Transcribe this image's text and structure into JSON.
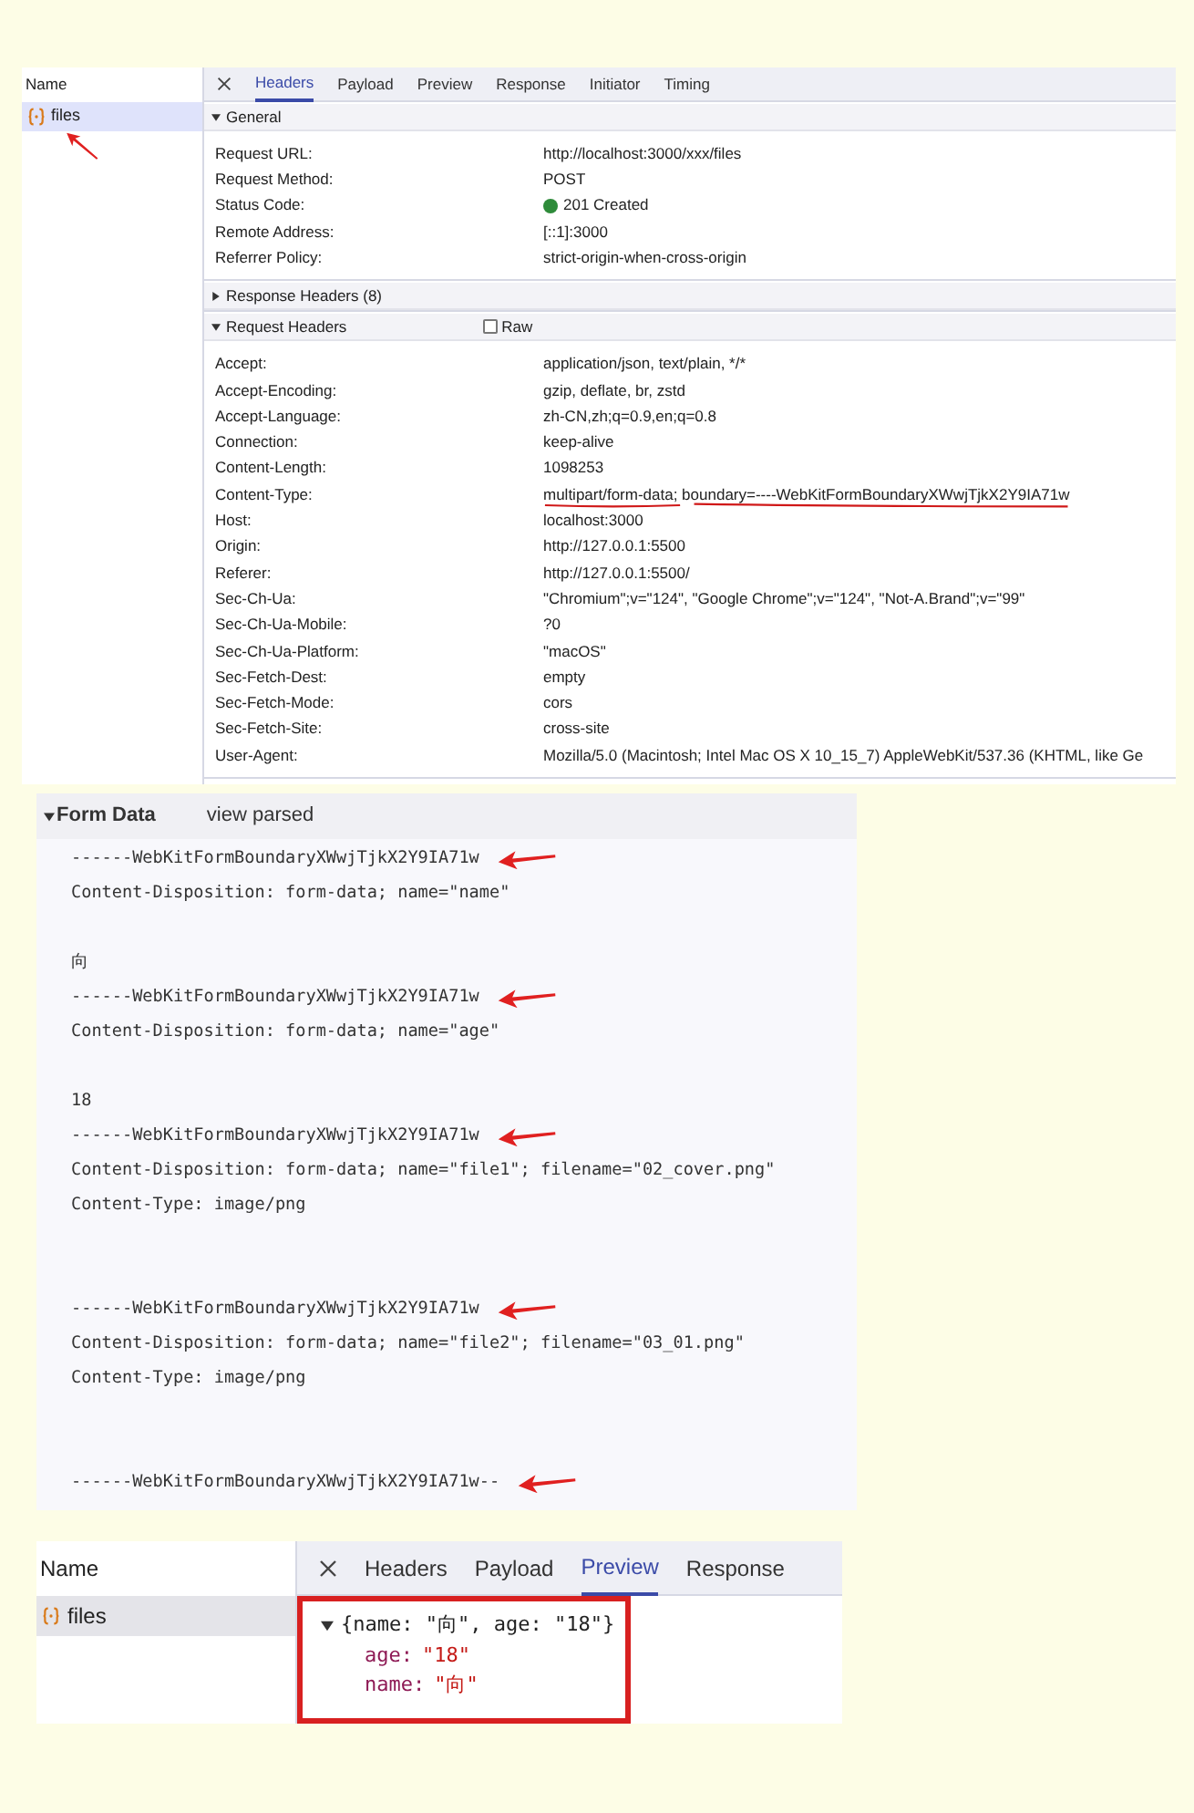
{
  "headers_view": {
    "name_column": {
      "heading": "Name",
      "items": [
        {
          "label": "files",
          "selected": true,
          "arrow": true
        }
      ]
    },
    "tabs": [
      {
        "label": "Headers",
        "selected": true
      },
      {
        "label": "Payload",
        "selected": false
      },
      {
        "label": "Preview",
        "selected": false
      },
      {
        "label": "Response",
        "selected": false
      },
      {
        "label": "Initiator",
        "selected": false
      },
      {
        "label": "Timing",
        "selected": false
      }
    ],
    "sections": [
      {
        "title": "General",
        "expanded": true,
        "rows": [
          {
            "name": "Request URL:",
            "value": "http://localhost:3000/xxx/files"
          },
          {
            "name": "Request Method:",
            "value": "POST"
          },
          {
            "name": "Status Code:",
            "value": "201 Created",
            "color": "#2e8b3a"
          },
          {
            "name": "Remote Address:",
            "value": "[::1]:3000"
          },
          {
            "name": "Referrer Policy:",
            "value": "strict-origin-when-cross-origin"
          }
        ]
      },
      {
        "title": "Response Headers (8)",
        "expanded": false
      },
      {
        "title": "Request Headers",
        "expanded": true,
        "raw": {
          "label": "Raw",
          "checked": false
        },
        "rows": [
          {
            "name": "Accept:",
            "value": "application/json, text/plain, */*"
          },
          {
            "name": "Accept-Encoding:",
            "value": "gzip, deflate, br, zstd"
          },
          {
            "name": "Accept-Language:",
            "value": "zh-CN,zh;q=0.9,en;q=0.8"
          },
          {
            "name": "Connection:",
            "value": "keep-alive"
          },
          {
            "name": "Content-Length:",
            "value": "1098253"
          },
          {
            "name": "Content-Type:",
            "value": "multipart/form-data; boundary=----WebKitFormBoundaryXWwjTjkX2Y9IA71w",
            "underlined": true
          },
          {
            "name": "Host:",
            "value": "localhost:3000"
          },
          {
            "name": "Origin:",
            "value": "http://127.0.0.1:5500"
          },
          {
            "name": "Referer:",
            "value": "http://127.0.0.1:5500/"
          },
          {
            "name": "Sec-Ch-Ua:",
            "value": "\"Chromium\";v=\"124\", \"Google Chrome\";v=\"124\", \"Not-A.Brand\";v=\"99\""
          },
          {
            "name": "Sec-Ch-Ua-Mobile:",
            "value": "?0"
          },
          {
            "name": "Sec-Ch-Ua-Platform:",
            "value": "\"macOS\""
          },
          {
            "name": "Sec-Fetch-Dest:",
            "value": "empty"
          },
          {
            "name": "Sec-Fetch-Mode:",
            "value": "cors"
          },
          {
            "name": "Sec-Fetch-Site:",
            "value": "cross-site"
          },
          {
            "name": "User-Agent:",
            "value": "Mozilla/5.0 (Macintosh; Intel Mac OS X 10_15_7) AppleWebKit/537.36 (KHTML, like Ge"
          }
        ]
      }
    ]
  },
  "form_data": {
    "title": "Form Data",
    "expanded": true,
    "link": "view parsed",
    "lines": [
      {
        "kind": "text",
        "text": "------WebKitFormBoundaryXWwjTjkX2Y9IA71w",
        "arrow": true
      },
      {
        "kind": "text",
        "text": "Content-Disposition: form-data; name=\"name\"",
        "arrow": false
      },
      {
        "kind": "blank"
      },
      {
        "kind": "text",
        "text": "向",
        "arrow": false
      },
      {
        "kind": "text",
        "text": "------WebKitFormBoundaryXWwjTjkX2Y9IA71w",
        "arrow": true
      },
      {
        "kind": "text",
        "text": "Content-Disposition: form-data; name=\"age\"",
        "arrow": false
      },
      {
        "kind": "blank"
      },
      {
        "kind": "text",
        "text": "18",
        "arrow": false
      },
      {
        "kind": "text",
        "text": "------WebKitFormBoundaryXWwjTjkX2Y9IA71w",
        "arrow": true
      },
      {
        "kind": "text",
        "text": "Content-Disposition: form-data; name=\"file1\"; filename=\"02_cover.png\"",
        "arrow": false
      },
      {
        "kind": "text",
        "text": "Content-Type: image/png",
        "arrow": false
      },
      {
        "kind": "blank"
      },
      {
        "kind": "blank"
      },
      {
        "kind": "text",
        "text": "------WebKitFormBoundaryXWwjTjkX2Y9IA71w",
        "arrow": true
      },
      {
        "kind": "text",
        "text": "Content-Disposition: form-data; name=\"file2\"; filename=\"03_01.png\"",
        "arrow": false
      },
      {
        "kind": "text",
        "text": "Content-Type: image/png",
        "arrow": false
      },
      {
        "kind": "blank"
      },
      {
        "kind": "blank"
      },
      {
        "kind": "text",
        "text": "------WebKitFormBoundaryXWwjTjkX2Y9IA71w--",
        "arrow": true
      }
    ]
  },
  "preview_view": {
    "name_column": {
      "heading": "Name",
      "items": [
        {
          "label": "files",
          "selected": true
        }
      ]
    },
    "tabs": [
      {
        "label": "Headers",
        "selected": false
      },
      {
        "label": "Payload",
        "selected": false
      },
      {
        "label": "Preview",
        "selected": true
      },
      {
        "label": "Response",
        "selected": false
      }
    ],
    "highlighted": true,
    "tree": {
      "label": "{name: \"向\", age: \"18\"}",
      "expanded": true,
      "children": [
        {
          "key": "age:",
          "value": "\"18\""
        },
        {
          "key": "name:",
          "value": "\"向\""
        }
      ]
    }
  }
}
